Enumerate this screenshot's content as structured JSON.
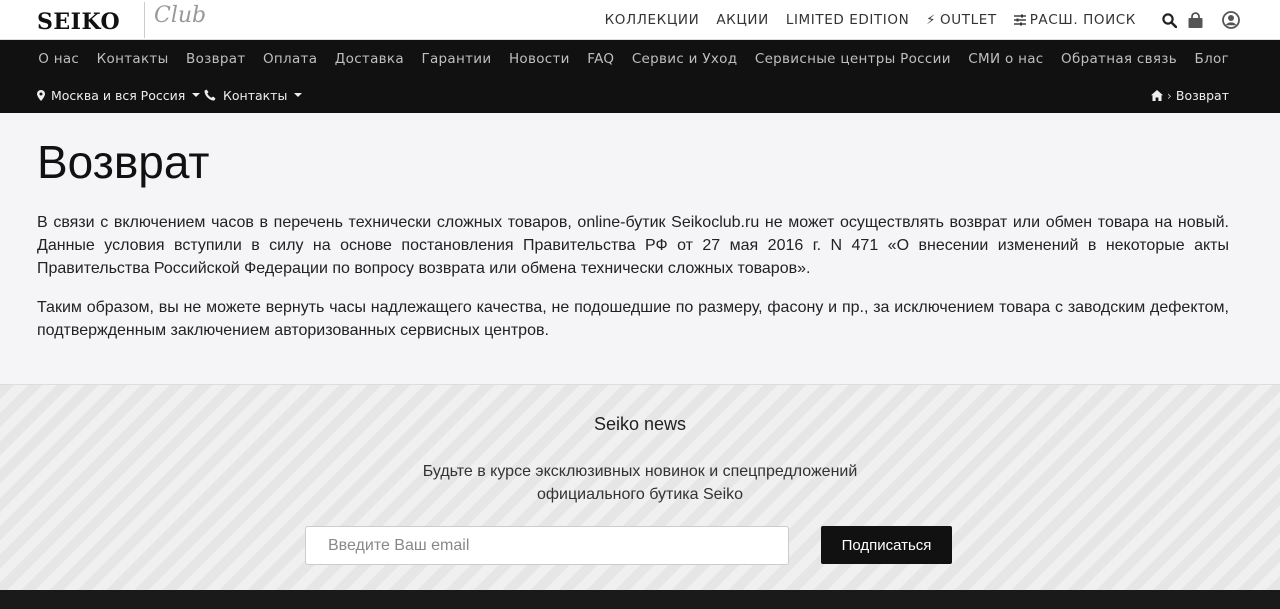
{
  "brand": {
    "logo": "SEIKO",
    "sub": "Club"
  },
  "topnav": {
    "collections": "КОЛЛЕКЦИИ",
    "actions": "АКЦИИ",
    "limited": "LIMITED EDITION",
    "outlet": "OUTLET",
    "search": "РАСШ. ПОИСК"
  },
  "menu": [
    "О нас",
    "Контакты",
    "Возврат",
    "Оплата",
    "Доставка",
    "Гарантии",
    "Новости",
    "FAQ",
    "Сервис и Уход",
    "Сервисные центры России",
    "СМИ о нас",
    "Обратная связь",
    "Блог"
  ],
  "location": "Москва и вся Россия",
  "contacts": "Контакты",
  "breadcrumb": {
    "current": "Возврат"
  },
  "page": {
    "title": "Возврат",
    "p1": "В связи с включением часов в перечень технически сложных товаров, online-бутик Seikoclub.ru не может осуществлять возврат или обмен товара на новый. Данные условия вступили в силу на основе постановления Правительства РФ от 27 мая 2016 г. N 471 «О внесении изменений в некоторые акты Правительства Российской Федерации по вопросу возврата или обмена технически сложных товаров».",
    "p2": "Таким образом, вы не можете вернуть часы надлежащего качества, не подошедшие по размеру, фасону и пр., за исключением товара с заводским дефектом, подтвержденным заключением авторизованных сервисных центров."
  },
  "newsletter": {
    "title": "Seiko news",
    "line1": "Будьте в курсе эксклюзивных новинок и спецпредложений",
    "line2": "официального бутика Seiko",
    "placeholder": "Введите Ваш email",
    "button": "Подписаться"
  }
}
